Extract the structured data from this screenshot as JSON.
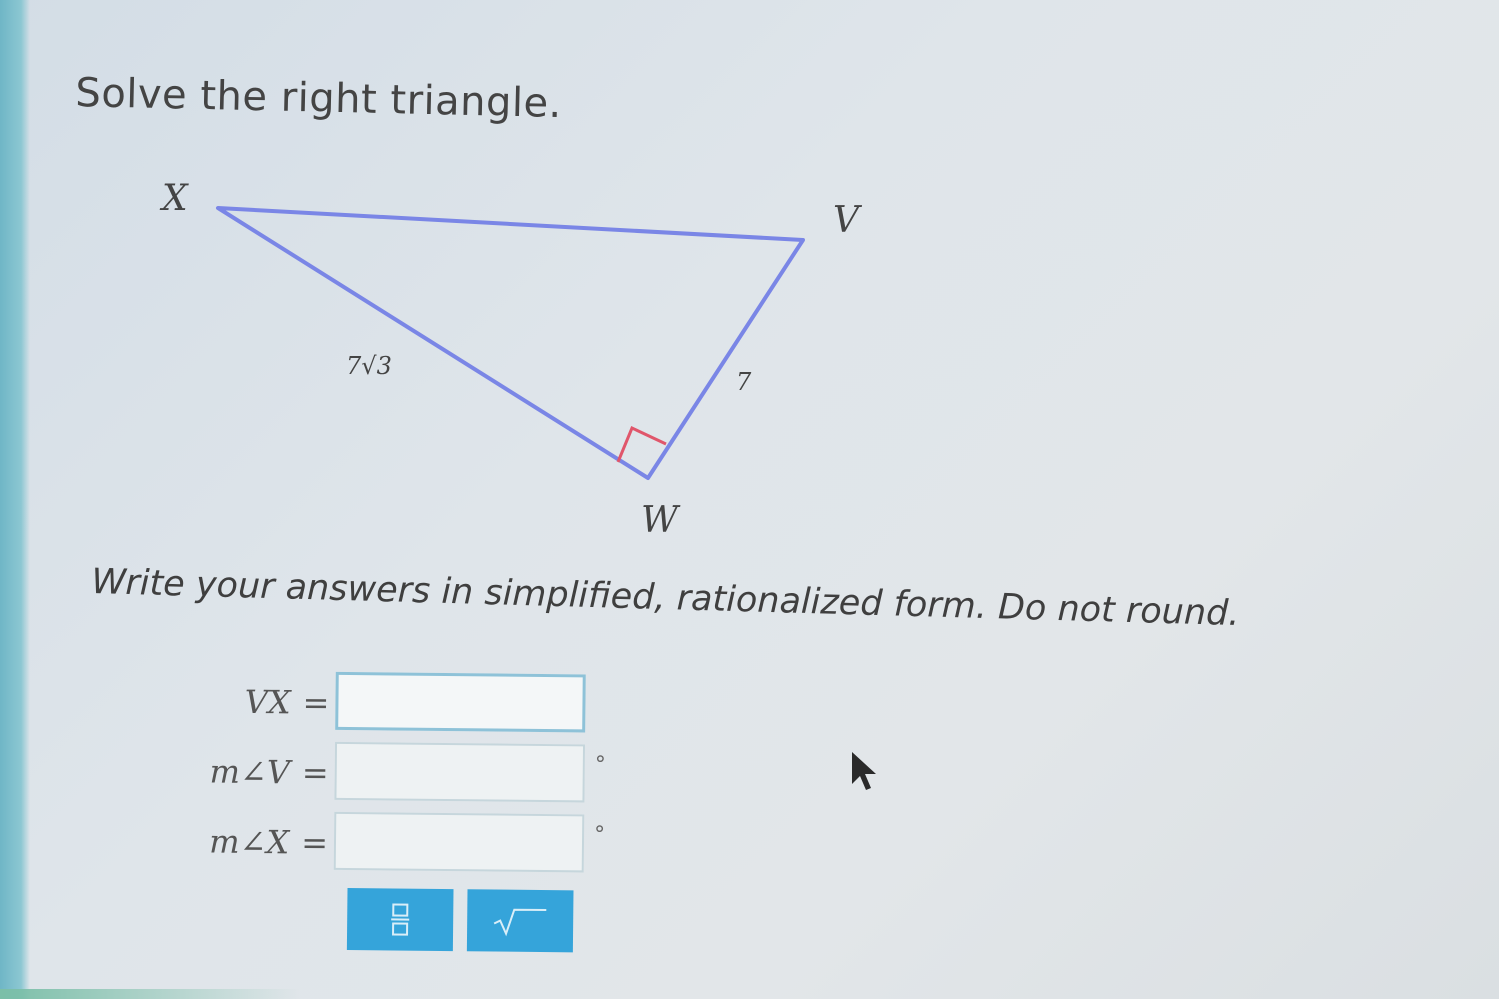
{
  "prompt": "Solve the right triangle.",
  "triangle": {
    "vertices": {
      "x": "X",
      "v": "V",
      "w": "W"
    },
    "sides": {
      "xw": "7√3",
      "vw": "7"
    },
    "line_color": "#7a86e6",
    "right_angle_color": "#e0566b"
  },
  "instructions": "Write your answers in simplified, rationalized form. Do not round.",
  "answers": [
    {
      "label": "VX",
      "value": "",
      "unit": ""
    },
    {
      "label": "m∠V",
      "value": "",
      "unit": "°"
    },
    {
      "label": "m∠X",
      "value": "",
      "unit": "°"
    }
  ],
  "toolbar": {
    "fraction_icon": "fraction-icon",
    "sqrt_icon": "square-root-icon",
    "button_color": "#35a4da"
  }
}
